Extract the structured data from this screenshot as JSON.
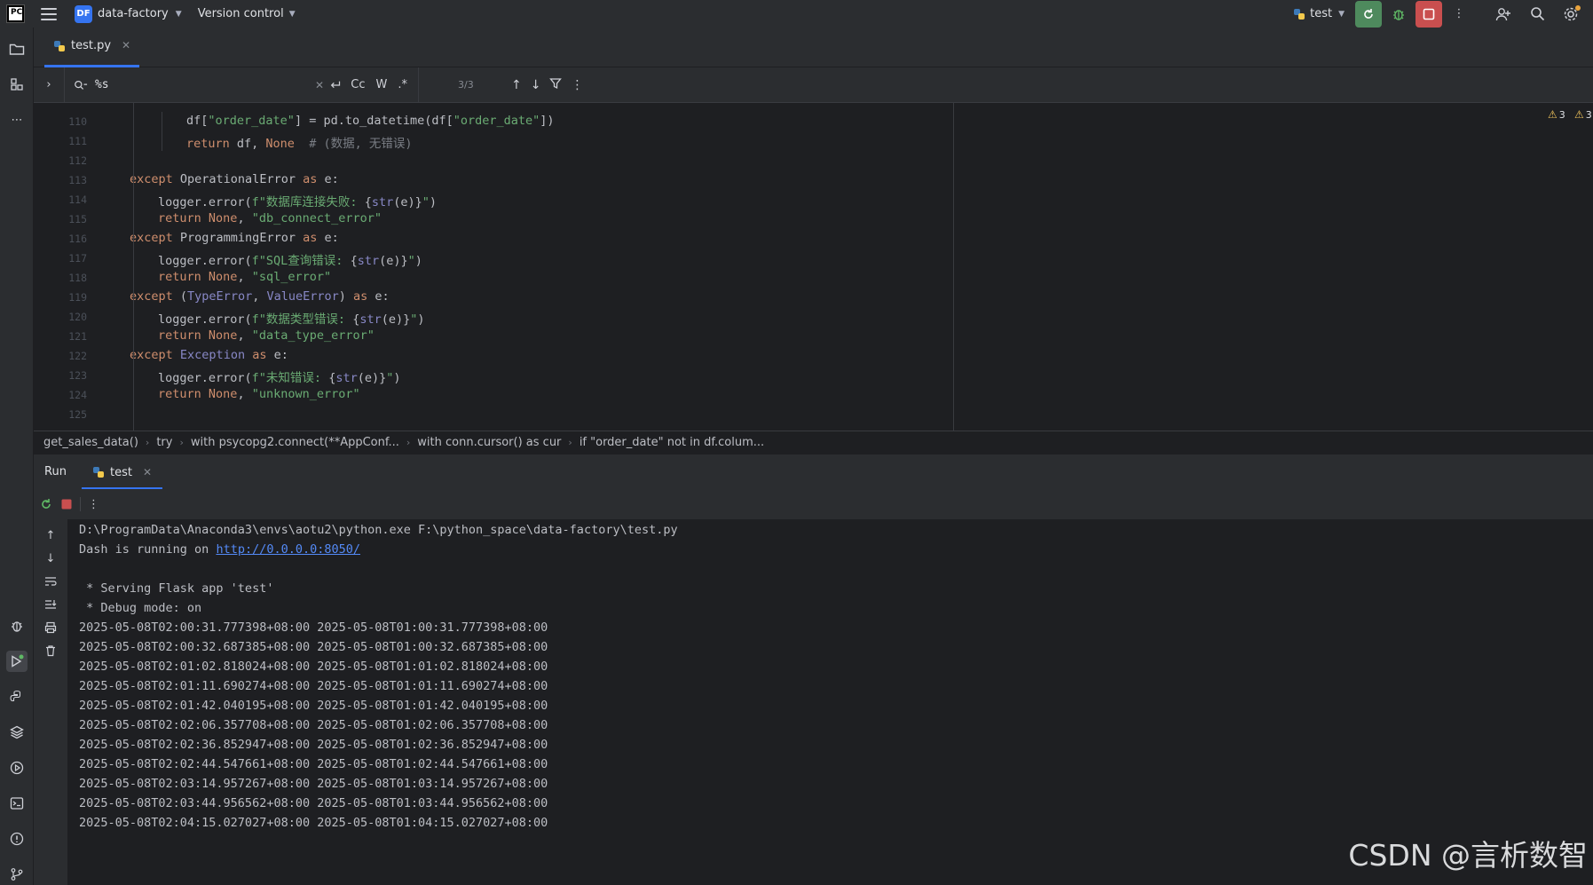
{
  "titlebar": {
    "logo": "PC",
    "project_badge": "DF",
    "project_name": "data-factory",
    "vcs_label": "Version control",
    "run_config": "test"
  },
  "editor": {
    "tab_label": "test.py",
    "find": {
      "query": "%s",
      "match_case": "Cc",
      "words": "W",
      "regex": ".*",
      "count": "3/3"
    },
    "warnings": [
      "3",
      "3"
    ],
    "lines": [
      {
        "n": "110",
        "indent": 3,
        "tokens": [
          [
            "t",
            "df["
          ],
          [
            "s",
            "\"order_date\""
          ],
          [
            "t",
            "] = pd.to_datetime(df["
          ],
          [
            "s",
            "\"order_date\""
          ],
          [
            "t",
            "])"
          ]
        ]
      },
      {
        "n": "111",
        "indent": 3,
        "tokens": [
          [
            "k",
            "return"
          ],
          [
            "t",
            " df, "
          ],
          [
            "k",
            "None"
          ],
          [
            "t",
            "  "
          ],
          [
            "c",
            "# (数据, 无错误)"
          ]
        ]
      },
      {
        "n": "112",
        "indent": 0,
        "tokens": []
      },
      {
        "n": "113",
        "indent": 1,
        "tokens": [
          [
            "k",
            "except"
          ],
          [
            "t",
            " OperationalError "
          ],
          [
            "k",
            "as"
          ],
          [
            "t",
            " e:"
          ]
        ]
      },
      {
        "n": "114",
        "indent": 2,
        "tokens": [
          [
            "t",
            "logger.error("
          ],
          [
            "s",
            "f\"数据库连接失败: "
          ],
          [
            "t",
            "{"
          ],
          [
            "b",
            "str"
          ],
          [
            "t",
            "(e)}"
          ],
          [
            "s",
            "\""
          ],
          [
            "t",
            ")"
          ]
        ]
      },
      {
        "n": "115",
        "indent": 2,
        "tokens": [
          [
            "k",
            "return"
          ],
          [
            "t",
            " "
          ],
          [
            "k",
            "None"
          ],
          [
            "t",
            ", "
          ],
          [
            "s",
            "\"db_connect_error\""
          ]
        ]
      },
      {
        "n": "116",
        "indent": 1,
        "tokens": [
          [
            "k",
            "except"
          ],
          [
            "t",
            " ProgrammingError "
          ],
          [
            "k",
            "as"
          ],
          [
            "t",
            " e:"
          ]
        ]
      },
      {
        "n": "117",
        "indent": 2,
        "tokens": [
          [
            "t",
            "logger.error("
          ],
          [
            "s",
            "f\"SQL查询错误: "
          ],
          [
            "t",
            "{"
          ],
          [
            "b",
            "str"
          ],
          [
            "t",
            "(e)}"
          ],
          [
            "s",
            "\""
          ],
          [
            "t",
            ")"
          ]
        ]
      },
      {
        "n": "118",
        "indent": 2,
        "tokens": [
          [
            "k",
            "return"
          ],
          [
            "t",
            " "
          ],
          [
            "k",
            "None"
          ],
          [
            "t",
            ", "
          ],
          [
            "s",
            "\"sql_error\""
          ]
        ]
      },
      {
        "n": "119",
        "indent": 1,
        "tokens": [
          [
            "k",
            "except"
          ],
          [
            "t",
            " ("
          ],
          [
            "b",
            "TypeError"
          ],
          [
            "t",
            ", "
          ],
          [
            "b",
            "ValueError"
          ],
          [
            "t",
            ") "
          ],
          [
            "k",
            "as"
          ],
          [
            "t",
            " e:"
          ]
        ]
      },
      {
        "n": "120",
        "indent": 2,
        "tokens": [
          [
            "t",
            "logger.error("
          ],
          [
            "s",
            "f\"数据类型错误: "
          ],
          [
            "t",
            "{"
          ],
          [
            "b",
            "str"
          ],
          [
            "t",
            "(e)}"
          ],
          [
            "s",
            "\""
          ],
          [
            "t",
            ")"
          ]
        ]
      },
      {
        "n": "121",
        "indent": 2,
        "tokens": [
          [
            "k",
            "return"
          ],
          [
            "t",
            " "
          ],
          [
            "k",
            "None"
          ],
          [
            "t",
            ", "
          ],
          [
            "s",
            "\"data_type_error\""
          ]
        ]
      },
      {
        "n": "122",
        "indent": 1,
        "tokens": [
          [
            "k",
            "except"
          ],
          [
            "t",
            " "
          ],
          [
            "b",
            "Exception"
          ],
          [
            "t",
            " "
          ],
          [
            "k",
            "as"
          ],
          [
            "t",
            " e:"
          ]
        ]
      },
      {
        "n": "123",
        "indent": 2,
        "tokens": [
          [
            "t",
            "logger.error("
          ],
          [
            "s",
            "f\"未知错误: "
          ],
          [
            "t",
            "{"
          ],
          [
            "b",
            "str"
          ],
          [
            "t",
            "(e)}"
          ],
          [
            "s",
            "\""
          ],
          [
            "t",
            ")"
          ]
        ]
      },
      {
        "n": "124",
        "indent": 2,
        "tokens": [
          [
            "k",
            "return"
          ],
          [
            "t",
            " "
          ],
          [
            "k",
            "None"
          ],
          [
            "t",
            ", "
          ],
          [
            "s",
            "\"unknown_error\""
          ]
        ]
      },
      {
        "n": "125",
        "indent": 0,
        "tokens": []
      }
    ]
  },
  "breadcrumb": [
    "get_sales_data()",
    "try",
    "with psycopg2.connect(**AppConf...",
    "with conn.cursor() as cur",
    "if \"order_date\" not in df.colum..."
  ],
  "run": {
    "title": "Run",
    "tab_label": "test",
    "console": [
      {
        "text": "D:\\ProgramData\\Anaconda3\\envs\\aotu2\\python.exe F:\\python_space\\data-factory\\test.py"
      },
      {
        "text": "Dash is running on ",
        "link": "http://0.0.0.0:8050/"
      },
      {
        "text": ""
      },
      {
        "text": " * Serving Flask app 'test'"
      },
      {
        "text": " * Debug mode: on"
      },
      {
        "text": "2025-05-08T02:00:31.777398+08:00 2025-05-08T01:00:31.777398+08:00"
      },
      {
        "text": "2025-05-08T02:00:32.687385+08:00 2025-05-08T01:00:32.687385+08:00"
      },
      {
        "text": "2025-05-08T02:01:02.818024+08:00 2025-05-08T01:01:02.818024+08:00"
      },
      {
        "text": "2025-05-08T02:01:11.690274+08:00 2025-05-08T01:01:11.690274+08:00"
      },
      {
        "text": "2025-05-08T02:01:42.040195+08:00 2025-05-08T01:01:42.040195+08:00"
      },
      {
        "text": "2025-05-08T02:02:06.357708+08:00 2025-05-08T01:02:06.357708+08:00"
      },
      {
        "text": "2025-05-08T02:02:36.852947+08:00 2025-05-08T01:02:36.852947+08:00"
      },
      {
        "text": "2025-05-08T02:02:44.547661+08:00 2025-05-08T01:02:44.547661+08:00"
      },
      {
        "text": "2025-05-08T02:03:14.957267+08:00 2025-05-08T01:03:14.957267+08:00"
      },
      {
        "text": "2025-05-08T02:03:44.956562+08:00 2025-05-08T01:03:44.956562+08:00"
      },
      {
        "text": "2025-05-08T02:04:15.027027+08:00 2025-05-08T01:04:15.027027+08:00"
      }
    ]
  },
  "watermark": "CSDN @言析数智",
  "colors": {
    "accent": "#3574f0",
    "keyword": "#cf8e6d",
    "string": "#6aab73",
    "builtin": "#8888c6",
    "rerun_green": "#4e8a5d",
    "stop_red": "#c94f4f"
  }
}
